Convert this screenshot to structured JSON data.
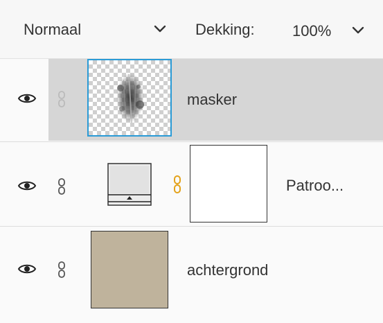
{
  "toolbar": {
    "blend_mode": "Normaal",
    "opacity_label": "Dekking:",
    "opacity_value": "100%"
  },
  "layers": [
    {
      "name": "masker",
      "selected": true,
      "visible": true,
      "thumbnail": "transparent-with-grunge-shape"
    },
    {
      "name": "Patroo...",
      "selected": false,
      "visible": true,
      "thumbnail": "pattern-adjustment",
      "mask_thumbnail": "white-mask",
      "mask_linked": true
    },
    {
      "name": "achtergrond",
      "selected": false,
      "visible": true,
      "thumbnail": "solid-beige",
      "thumbnail_color": "#bfb39c"
    }
  ],
  "colors": {
    "selection_highlight": "#d6d6d6",
    "thumbnail_selected_border": "#2a9bd6",
    "mask_link_color": "#e3a21a"
  },
  "icons": [
    "eye-icon",
    "chain-link-icon",
    "chevron-down-icon"
  ]
}
